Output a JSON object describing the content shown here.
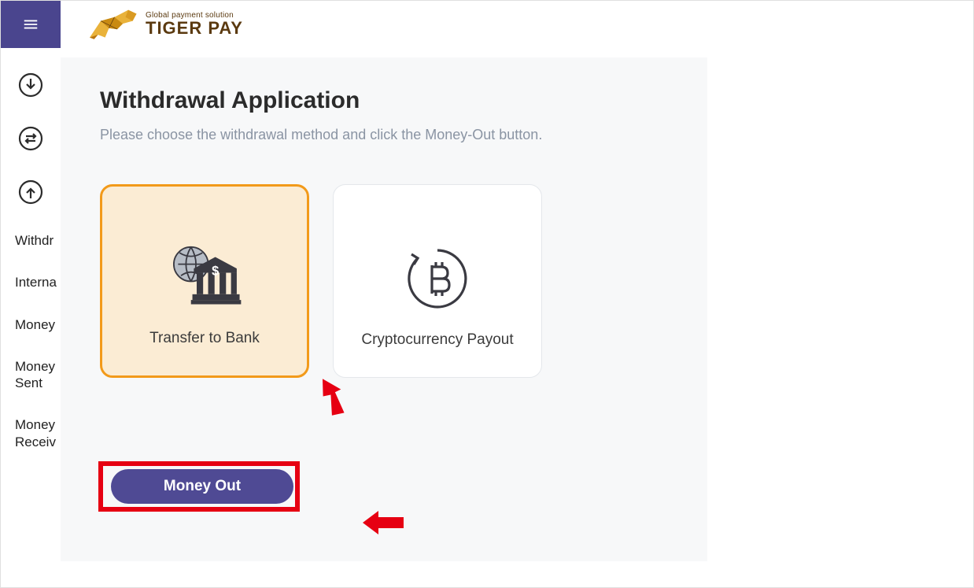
{
  "brand": {
    "tagline": "Global payment solution",
    "name": "TIGER PAY"
  },
  "sidebar": {
    "labels": [
      "Withdr",
      "Interna",
      "Money",
      "Money Sent",
      "Money Receiv"
    ]
  },
  "page": {
    "title": "Withdrawal Application",
    "instructions": "Please choose the withdrawal method and click the Money-Out button."
  },
  "methods": [
    {
      "label": "Transfer to Bank",
      "selected": true
    },
    {
      "label": "Cryptocurrency Payout",
      "selected": false
    }
  ],
  "action": {
    "money_out": "Money Out"
  },
  "colors": {
    "primary": "#4a458e",
    "accent": "#f29a1a",
    "highlight": "#e60012"
  }
}
